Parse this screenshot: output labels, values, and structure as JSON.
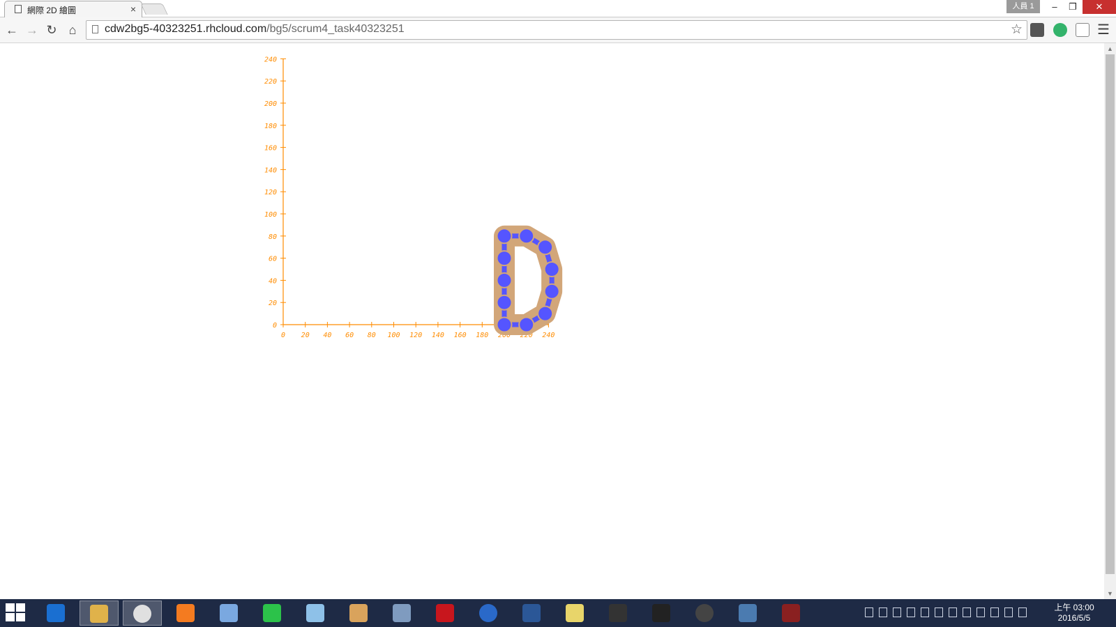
{
  "browser": {
    "tab_title": "網際 2D 繪圖",
    "tab_close": "×",
    "profile_name": "人員 1",
    "url_host": "cdw2bg5-40323251.rhcloud.com",
    "url_path": "/bg5/scrum4_task40323251"
  },
  "icons": {
    "back": "arrow-left-icon",
    "forward": "arrow-right-icon",
    "reload": "reload-icon",
    "home": "home-icon",
    "bookmark": "star-icon",
    "menu": "hamburger-menu-icon"
  },
  "chart_data": {
    "type": "scatter",
    "title": "",
    "xlabel": "",
    "ylabel": "",
    "xlim": [
      0,
      240
    ],
    "ylim": [
      0,
      240
    ],
    "x_ticks": [
      0,
      20,
      40,
      60,
      80,
      100,
      120,
      140,
      160,
      180,
      200,
      220,
      240
    ],
    "y_ticks": [
      0,
      20,
      40,
      60,
      80,
      100,
      120,
      140,
      160,
      180,
      200,
      220,
      240
    ],
    "axis_color": "#ff8c00",
    "shape_fill_color": "#d2a679",
    "point_color": "#5555ff",
    "points": [
      {
        "x": 200,
        "y": 0
      },
      {
        "x": 200,
        "y": 20
      },
      {
        "x": 200,
        "y": 40
      },
      {
        "x": 200,
        "y": 60
      },
      {
        "x": 200,
        "y": 80
      },
      {
        "x": 220,
        "y": 80
      },
      {
        "x": 237,
        "y": 70
      },
      {
        "x": 243,
        "y": 50
      },
      {
        "x": 243,
        "y": 30
      },
      {
        "x": 237,
        "y": 10
      },
      {
        "x": 220,
        "y": 0
      }
    ]
  },
  "taskbar": {
    "apps": [
      "start",
      "internet-explorer",
      "file-explorer",
      "chrome",
      "media-player",
      "bird-app",
      "line",
      "notes",
      "paint",
      "calculator",
      "acrobat",
      "moon-app",
      "word",
      "folder",
      "321-app",
      "cmd",
      "sphere-app",
      "python",
      "cat-app"
    ],
    "clock_time": "上午 03:00",
    "clock_date": "2016/5/5"
  }
}
